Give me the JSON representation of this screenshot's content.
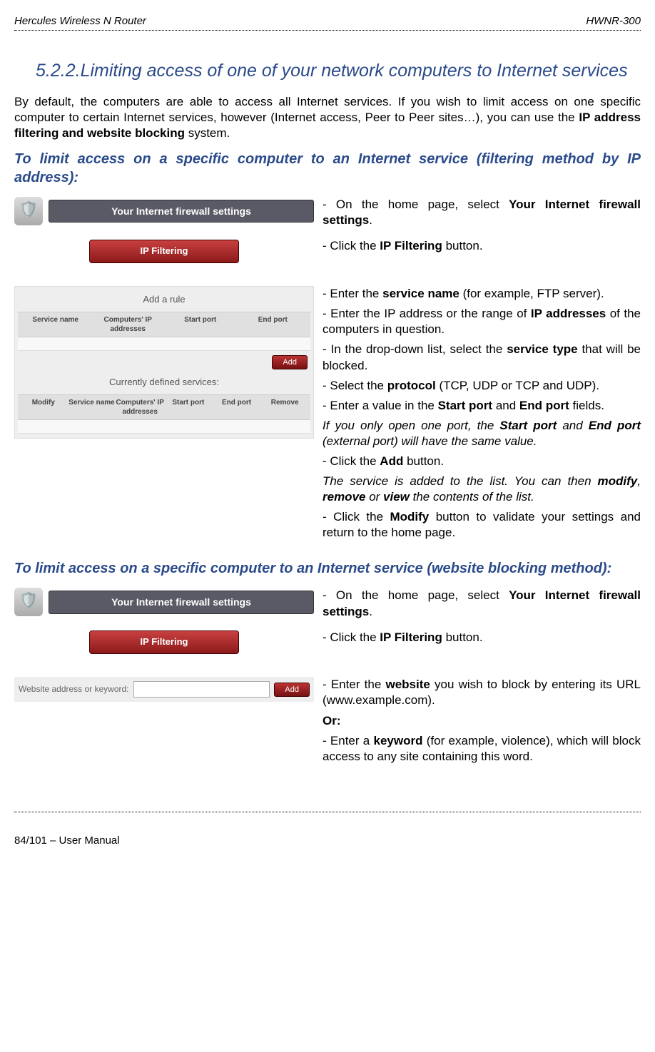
{
  "header": {
    "left": "Hercules Wireless N Router",
    "right": "HWNR-300"
  },
  "section": {
    "number": "5.2.2.",
    "title": "Limiting access of one of your network computers to Internet services"
  },
  "intro": {
    "t1": "By default, the computers are able to access all Internet services.  If you wish to limit access on one specific computer to certain Internet services, however (Internet access, Peer to Peer sites…), you can use the ",
    "b1": "IP address filtering and website blocking",
    "t2": " system."
  },
  "sub1": "To limit access on a specific computer to an Internet service (filtering method by IP address):",
  "panels": {
    "firewall_bar": "Your Internet firewall settings",
    "ip_filtering": "IP Filtering",
    "add_rule": "Add a rule",
    "cols1": [
      "Service name",
      "Computers' IP addresses",
      "Start port",
      "End port"
    ],
    "add_btn": "Add",
    "currently_defined": "Currently defined services:",
    "cols2": [
      "Modify",
      "Service name",
      "Computers' IP addresses",
      "Start port",
      "End port",
      "Remove"
    ],
    "website_label": "Website address or keyword:"
  },
  "steps1": {
    "s1a": "- On the home page, select ",
    "s1b": "Your Internet firewall settings",
    "s1c": ".",
    "s2a": "- Click the ",
    "s2b": "IP Filtering",
    "s2c": " button.",
    "s3a": "- Enter the ",
    "s3b": "service name",
    "s3c": " (for example, FTP server).",
    "s4a": "- Enter the IP address or the range of ",
    "s4b": "IP addresses",
    "s4c": " of the computers in question.",
    "s5a": "- In the drop-down list, select the ",
    "s5b": "service type",
    "s5c": " that will be blocked.",
    "s6a": "- Select the ",
    "s6b": "protocol",
    "s6c": " (TCP, UDP or TCP and UDP).",
    "s7a": "- Enter a value in the ",
    "s7b": "Start port",
    "s7c": " and ",
    "s7d": "End port",
    "s7e": " fields.",
    "s8a": "If you only open one port, the ",
    "s8b": "Start port",
    "s8c": " and ",
    "s8d": "End port",
    "s8e": " (external port) will have the same value.",
    "s9a": "- Click the ",
    "s9b": "Add",
    "s9c": " button.",
    "s10a": "The service is added to the list.  You can then ",
    "s10b": "modify",
    "s10c": ", ",
    "s10d": "remove",
    "s10e": " or ",
    "s10f": "view",
    "s10g": " the contents of the list.",
    "s11a": "- Click the ",
    "s11b": "Modify",
    "s11c": " button to validate your settings and return to the home page."
  },
  "sub2": "To limit access on a specific computer to an Internet service (website blocking method):",
  "steps2": {
    "s1a": "- On the home page, select ",
    "s1b": "Your Internet firewall settings",
    "s1c": ".",
    "s2a": "- Click the ",
    "s2b": "IP Filtering",
    "s2c": " button.",
    "s3a": "- Enter the ",
    "s3b": "website",
    "s3c": " you wish to block by entering its URL (www.example.com).",
    "or": "Or:",
    "s4a": "- Enter a ",
    "s4b": "keyword",
    "s4c": " (for example, violence), which will block access to any site containing this word."
  },
  "footer": "84/101 – User Manual"
}
